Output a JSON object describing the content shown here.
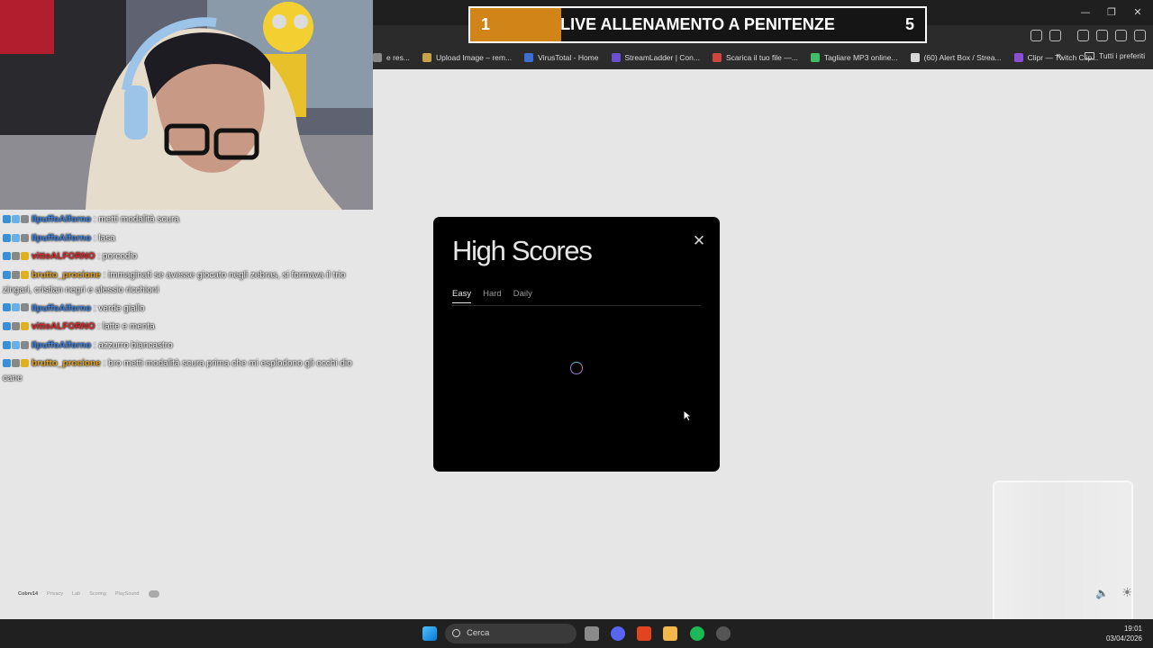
{
  "banner": {
    "current": "1",
    "title": "LIVE ALLENAMENTO A PENITENZE",
    "total": "5",
    "progress_fraction": 0.2
  },
  "bookmarks": [
    {
      "label": "e res...",
      "color": "#8a8a8a"
    },
    {
      "label": "Upload Image – rem...",
      "color": "#c9a24a"
    },
    {
      "label": "VirusTotal - Home",
      "color": "#3b6fd1"
    },
    {
      "label": "StreamLadder | Con...",
      "color": "#6a4fd0"
    },
    {
      "label": "Scarica il tuo file —...",
      "color": "#d0453b"
    },
    {
      "label": "Tagliare MP3 online...",
      "color": "#3fbf6a"
    },
    {
      "label": "(60) Alert Box / Strea...",
      "color": "#d8d8d8"
    },
    {
      "label": "Clipr — Twitch Clip...",
      "color": "#8b4fd6"
    }
  ],
  "bookmarks_all": "Tutti i preferiti",
  "chat": [
    {
      "user": "IlpuffoAlforno",
      "color": "#3a7fe0",
      "message": ": metti modalità scura",
      "badges": [
        "#3a8fd9",
        "#6ab0e8",
        "#888888"
      ]
    },
    {
      "user": "IlpuffoAlforno",
      "color": "#3a7fe0",
      "message": ": lasa",
      "badges": [
        "#3a8fd9",
        "#6ab0e8",
        "#888888"
      ]
    },
    {
      "user": "vittoALFORNO",
      "color": "#e02424",
      "message": ": porcodio",
      "badges": [
        "#3a8fd9",
        "#888888",
        "#e0b020"
      ]
    },
    {
      "user": "brutto_procione",
      "color": "#e0a020",
      "message": ": immaginati se avesse giocato negli zebras, si formava il trio zingari, cristian negri e alessio ricchioni",
      "badges": [
        "#3a8fd9",
        "#888888",
        "#e0b020"
      ]
    },
    {
      "user": "IlpuffoAlforno",
      "color": "#3a7fe0",
      "message": ": verde giallo",
      "badges": [
        "#3a8fd9",
        "#6ab0e8",
        "#888888"
      ]
    },
    {
      "user": "vittoALFORNO",
      "color": "#e02424",
      "message": ": latte e menta",
      "badges": [
        "#3a8fd9",
        "#888888",
        "#e0b020"
      ]
    },
    {
      "user": "IlpuffoAlforno",
      "color": "#3a7fe0",
      "message": ": azzurro biancastro",
      "badges": [
        "#3a8fd9",
        "#6ab0e8",
        "#888888"
      ]
    },
    {
      "user": "brutto_procione",
      "color": "#e0a020",
      "message": ": bro metti modalità scura prima che mi esplodono gli occhi dio cane",
      "badges": [
        "#3a8fd9",
        "#888888",
        "#e0b020"
      ]
    }
  ],
  "modal": {
    "title": "High Scores",
    "close_icon": "close-icon",
    "tabs": [
      {
        "label": "Easy",
        "active": true
      },
      {
        "label": "Hard"
      },
      {
        "label": "Daily"
      }
    ]
  },
  "footer": {
    "brand": "Cobrv14",
    "links": [
      "Privacy",
      "Lab",
      "Scoring",
      "PlaySound"
    ],
    "badge": ""
  },
  "taskbar": {
    "search_placeholder": "Cerca",
    "time": "19:01",
    "date": "03/04/2026"
  }
}
